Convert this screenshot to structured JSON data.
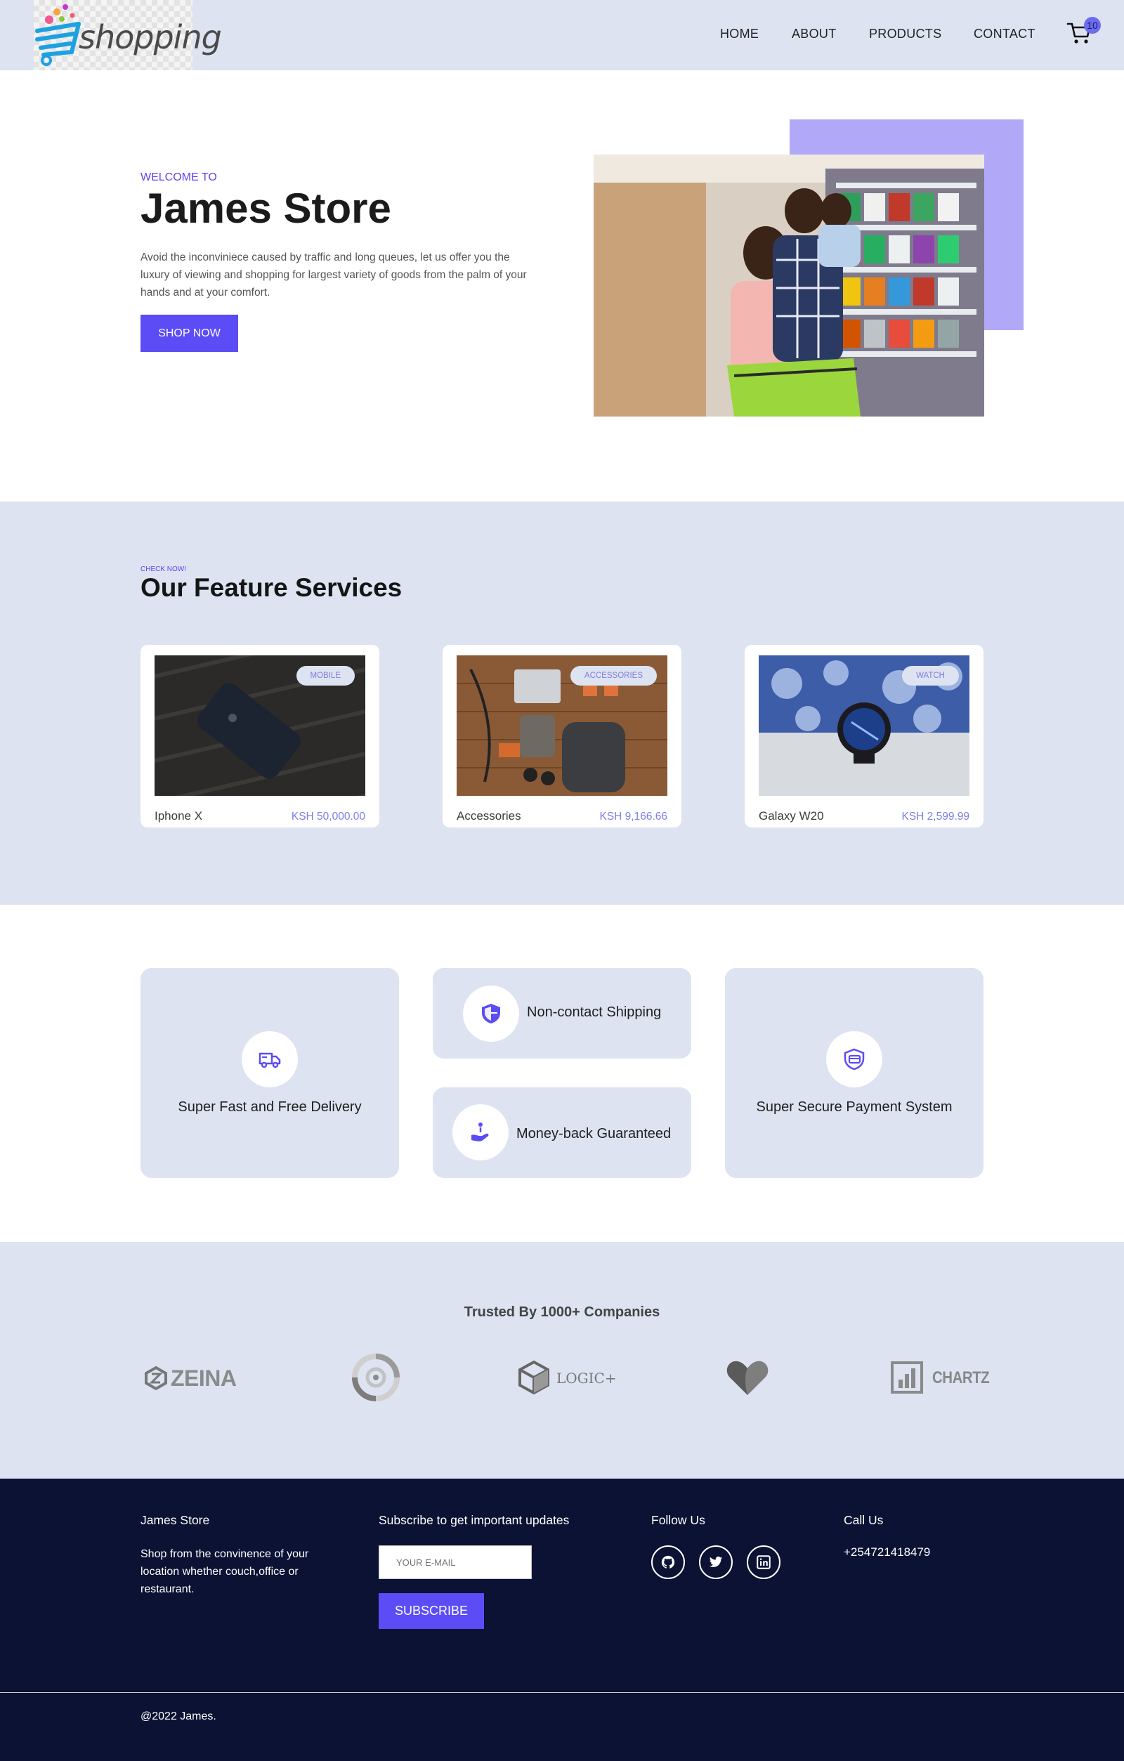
{
  "header": {
    "logo_text": "shopping",
    "nav": [
      "HOME",
      "ABOUT",
      "PRODUCTS",
      "CONTACT"
    ],
    "cart_count": "10"
  },
  "hero": {
    "eyebrow": "WELCOME TO",
    "title": "James Store",
    "description": "Avoid the inconviniece caused by traffic and long queues, let us offer you the luxury of viewing and shopping for largest variety of goods from the palm of your hands and at your comfort.",
    "cta": "SHOP NOW"
  },
  "featured": {
    "eyebrow": "CHECK NOW!",
    "title": "Our Feature Services",
    "cards": [
      {
        "tag": "MOBILE",
        "name": "Iphone X",
        "price": "KSH 50,000.00"
      },
      {
        "tag": "ACCESSORIES",
        "name": "Accessories",
        "price": "KSH 9,166.66"
      },
      {
        "tag": "WATCH",
        "name": "Galaxy W20",
        "price": "KSH 2,599.99"
      }
    ]
  },
  "services": {
    "delivery": "Super Fast and Free Delivery",
    "shipping": "Non-contact Shipping",
    "moneyback": "Money-back Guaranteed",
    "payment": "Super Secure Payment System"
  },
  "trusted": {
    "title": "Trusted By 1000+ Companies",
    "brands": [
      "ZEINA",
      "LOGIC+",
      "CHARTZ"
    ]
  },
  "footer": {
    "brand_title": "James Store",
    "brand_text": "Shop from the convinence of your location whether couch,office or restaurant.",
    "subscribe_title": "Subscribe to get important updates",
    "email_placeholder": "YOUR E-MAIL",
    "subscribe_button": "SUBSCRIBE",
    "follow_title": "Follow Us",
    "call_title": "Call Us",
    "phone": "+254721418479",
    "copyright": "@2022 James."
  },
  "colors": {
    "accent": "#5b4cf5",
    "light_bg": "#dde3f1",
    "footer_bg": "#0b1233",
    "hero_accent": "#b1a9f7"
  }
}
